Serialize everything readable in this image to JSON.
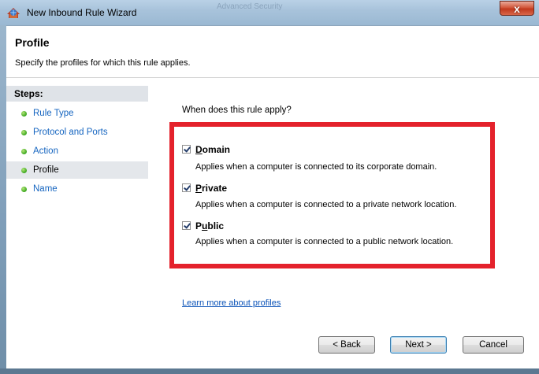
{
  "window": {
    "title": "New Inbound Rule Wizard",
    "ghost_title": "Advanced Security",
    "close_glyph": "x"
  },
  "header": {
    "title": "Profile",
    "subtitle": "Specify the profiles for which this rule applies."
  },
  "steps": {
    "title": "Steps:",
    "items": [
      {
        "label": "Rule Type"
      },
      {
        "label": "Protocol and Ports"
      },
      {
        "label": "Action"
      },
      {
        "label": "Profile"
      },
      {
        "label": "Name"
      }
    ],
    "active_index": 3
  },
  "main": {
    "question": "When does this rule apply?",
    "options": [
      {
        "label_u": "D",
        "label_rest": "omain",
        "checked": true,
        "description": "Applies when a computer is connected to its corporate domain."
      },
      {
        "label_u": "P",
        "label_rest": "rivate",
        "checked": true,
        "description": "Applies when a computer is connected to a private network location."
      },
      {
        "label_pre": "P",
        "label_u": "u",
        "label_rest": "blic",
        "checked": true,
        "description": "Applies when a computer is connected to a public network location."
      }
    ],
    "learn_more": "Learn more about profiles"
  },
  "buttons": {
    "back": "< Back",
    "next": "Next >",
    "cancel": "Cancel"
  },
  "colors": {
    "highlight": "#e4222c",
    "link": "#1565c0",
    "step_dot": "#38a51c"
  },
  "icons": {
    "window": "firewall-icon",
    "close": "close-icon",
    "bullet": "green-dot-icon"
  }
}
